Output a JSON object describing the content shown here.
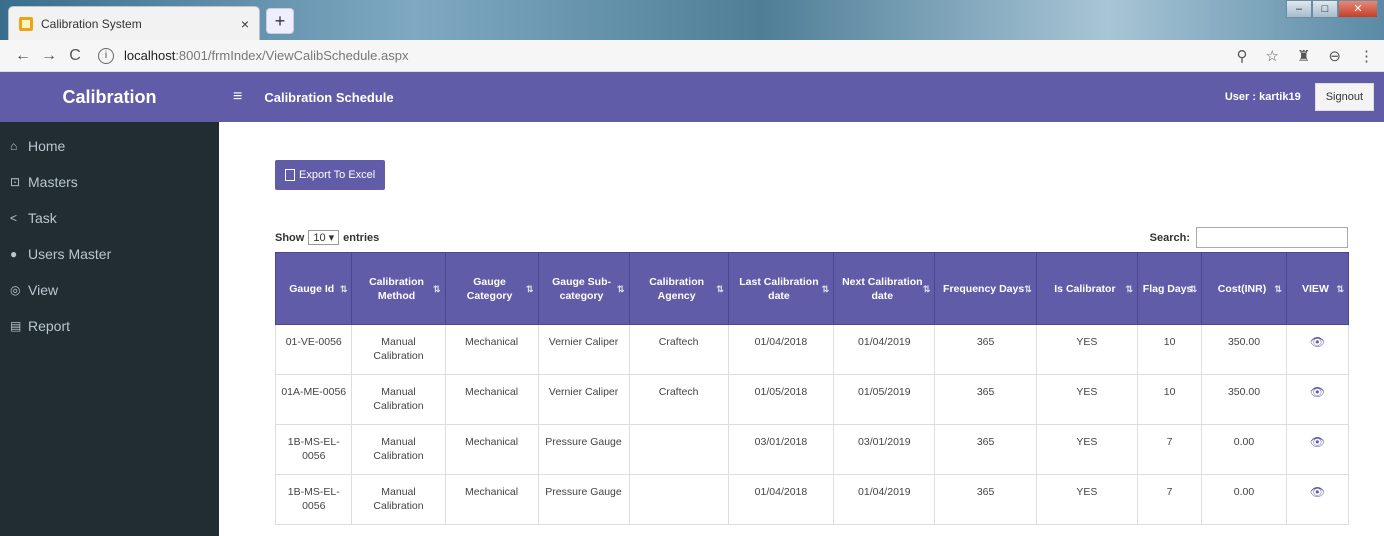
{
  "browser": {
    "tab_title": "Calibration System",
    "tab_close": "×",
    "new_tab": "+",
    "url_host": "localhost",
    "url_path": ":8001/frmIndex/ViewCalibSchedule.aspx",
    "nav_back": "←",
    "nav_forward": "→",
    "nav_reload": "C",
    "info": "ⓘ",
    "icons": [
      "zoom-icon",
      "star-icon",
      "extension-icon",
      "account-icon",
      "menu-icon"
    ]
  },
  "sidebar": {
    "brand": "Calibration",
    "items": [
      {
        "icon": "⌂",
        "label": "Home"
      },
      {
        "icon": "⊡",
        "label": "Masters"
      },
      {
        "icon": "<",
        "label": "Task"
      },
      {
        "icon": "●",
        "label": "Users Master"
      },
      {
        "icon": "◎",
        "label": "View"
      },
      {
        "icon": "▤",
        "label": "Report"
      }
    ]
  },
  "topbar": {
    "burger": "≡",
    "title": "Calibration Schedule",
    "user": "User : kartik19",
    "signout": "Signout"
  },
  "content": {
    "export_label": "Export To Excel",
    "show_prefix": "Show",
    "show_value": "10",
    "show_suffix": "entries",
    "search_label": "Search:",
    "columns": [
      "Gauge Id",
      "Calibration Method",
      "Gauge Category",
      "Gauge Sub-category",
      "Calibration Agency",
      "Last Calibration date",
      "Next Calibration date",
      "Frequency Days",
      "Is Calibrator",
      "Flag Days",
      "Cost(INR)",
      "VIEW"
    ],
    "rows": [
      [
        "01-VE-0056",
        "Manual Calibration",
        "Mechanical",
        "Vernier Caliper",
        "Craftech",
        "01/04/2018",
        "01/04/2019",
        "365",
        "YES",
        "10",
        "350.00",
        "👁"
      ],
      [
        "01A-ME-0056",
        "Manual Calibration",
        "Mechanical",
        "Vernier Caliper",
        "Craftech",
        "01/05/2018",
        "01/05/2019",
        "365",
        "YES",
        "10",
        "350.00",
        "👁"
      ],
      [
        "1B-MS-EL-0056",
        "Manual Calibration",
        "Mechanical",
        "Pressure Gauge",
        "",
        "03/01/2018",
        "03/01/2019",
        "365",
        "YES",
        "7",
        "0.00",
        "👁"
      ],
      [
        "1B-MS-EL-0056",
        "Manual Calibration",
        "Mechanical",
        "Pressure Gauge",
        "",
        "01/04/2018",
        "01/04/2019",
        "365",
        "YES",
        "7",
        "0.00",
        "👁"
      ]
    ]
  }
}
